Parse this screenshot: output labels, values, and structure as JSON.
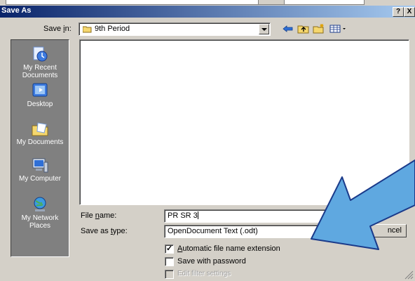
{
  "window": {
    "title": "Save As",
    "help_button": "?",
    "close_button": "X"
  },
  "toolbar": {
    "save_in_label": "Save in:",
    "save_in_mnemonic": "i",
    "save_in_value": "9th Period",
    "icons": [
      "back-icon",
      "up-folder-icon",
      "new-folder-icon",
      "views-menu-icon"
    ]
  },
  "places": [
    {
      "label": "My Recent Documents",
      "icon": "recent-documents-icon"
    },
    {
      "label": "Desktop",
      "icon": "desktop-icon"
    },
    {
      "label": "My Documents",
      "icon": "my-documents-icon"
    },
    {
      "label": "My Computer",
      "icon": "my-computer-icon"
    },
    {
      "label": "My Network Places",
      "icon": "network-places-icon"
    }
  ],
  "form": {
    "file_name_label": "File name:",
    "file_name_value": "PR SR 3",
    "save_as_type_label": "Save as type:",
    "save_as_type_value": "OpenDocument Text (.odt)",
    "cancel_label": "ncel"
  },
  "options": {
    "auto_extension_label": "Automatic file name extension",
    "auto_extension_checked": true,
    "password_label": "Save with password",
    "password_checked": false,
    "filter_label": "Edit filter settings",
    "filter_checked": false,
    "filter_enabled": false
  },
  "colors": {
    "title_gradient_start": "#0a246a",
    "title_gradient_end": "#a6caf0",
    "dialog_face": "#d4d0c8",
    "places_bar": "#808080",
    "annotation_arrow_fill": "#5fa8e0",
    "annotation_arrow_stroke": "#1a3a8a"
  }
}
